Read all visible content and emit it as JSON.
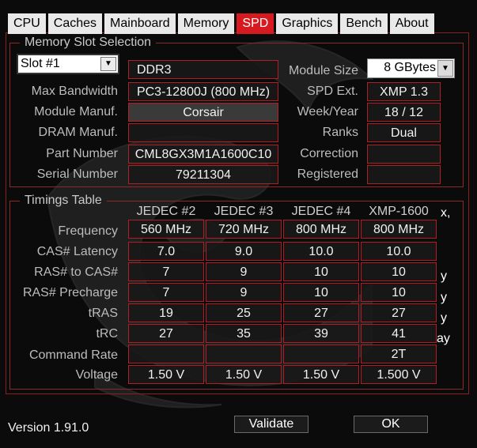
{
  "tabs": [
    "CPU",
    "Caches",
    "Mainboard",
    "Memory",
    "SPD",
    "Graphics",
    "Bench",
    "About"
  ],
  "active_tab": "SPD",
  "slot_group": {
    "title": "Memory Slot Selection",
    "slot_select": "Slot #1",
    "memory_type": "DDR3",
    "labels": {
      "max_bandwidth": "Max Bandwidth",
      "module_manuf": "Module Manuf.",
      "dram_manuf": "DRAM Manuf.",
      "part_number": "Part Number",
      "serial_number": "Serial Number",
      "module_size": "Module Size",
      "spd_ext": "SPD Ext.",
      "week_year": "Week/Year",
      "ranks": "Ranks",
      "correction": "Correction",
      "registered": "Registered"
    },
    "values": {
      "max_bandwidth": "PC3-12800J (800 MHz)",
      "module_manuf": "Corsair",
      "dram_manuf": "",
      "part_number": "CML8GX3M1A1600C10",
      "serial_number": "79211304",
      "module_size": "8 GBytes",
      "spd_ext": "XMP 1.3",
      "week_year": "18 / 12",
      "ranks": "Dual",
      "correction": "",
      "registered": ""
    }
  },
  "timings": {
    "title": "Timings Table",
    "columns": [
      "JEDEC #2",
      "JEDEC #3",
      "JEDEC #4",
      "XMP-1600"
    ],
    "rows": [
      {
        "label": "Frequency",
        "values": [
          "560 MHz",
          "720 MHz",
          "800 MHz",
          "800 MHz"
        ]
      },
      {
        "label": "CAS# Latency",
        "values": [
          "7.0",
          "9.0",
          "10.0",
          "10.0"
        ]
      },
      {
        "label": "RAS# to CAS#",
        "values": [
          "7",
          "9",
          "10",
          "10"
        ]
      },
      {
        "label": "RAS# Precharge",
        "values": [
          "7",
          "9",
          "10",
          "10"
        ]
      },
      {
        "label": "tRAS",
        "values": [
          "19",
          "25",
          "27",
          "27"
        ]
      },
      {
        "label": "tRC",
        "values": [
          "27",
          "35",
          "39",
          "41"
        ]
      },
      {
        "label": "Command Rate",
        "values": [
          "",
          "",
          "",
          "2T"
        ]
      },
      {
        "label": "Voltage",
        "values": [
          "1.50 V",
          "1.50 V",
          "1.50 V",
          "1.500 V"
        ]
      }
    ],
    "edge_fragments": [
      "x,",
      "y",
      "y",
      "y",
      "ay"
    ]
  },
  "footer": {
    "version": "Version 1.91.0",
    "validate": "Validate",
    "ok": "OK"
  },
  "colors": {
    "accent": "#d61a20",
    "border": "#b01f24",
    "background": "#0b0b0b"
  }
}
